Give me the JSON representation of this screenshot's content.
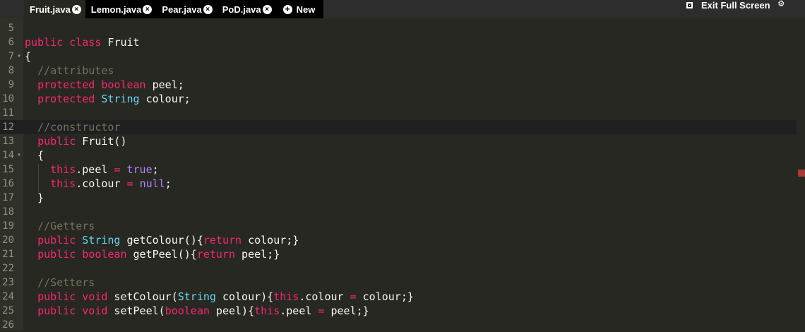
{
  "tabs": [
    {
      "label": "Fruit.java",
      "active": true
    },
    {
      "label": "Lemon.java",
      "active": false
    },
    {
      "label": "Pear.java",
      "active": false
    },
    {
      "label": "PoD.java",
      "active": false
    }
  ],
  "new_tab_label": "New",
  "fullscreen_label": "Exit Full Screen",
  "icons": {
    "close": "close-circle-icon",
    "new": "plus-circle-icon",
    "fullscreen": "exit-fullscreen-icon",
    "settings": "gear-icon",
    "fold": "fold-arrow-icon"
  },
  "colors": {
    "background": "#272822",
    "gutter": "#2f3129",
    "keyword": "#f92672",
    "type": "#66d9ef",
    "comment": "#75715e",
    "literal": "#ae81ff",
    "text": "#f8f8f2"
  },
  "current_line": 12,
  "code_lines": [
    {
      "n": 5,
      "tokens": []
    },
    {
      "n": 6,
      "tokens": [
        [
          "k",
          "public"
        ],
        [
          "p",
          " "
        ],
        [
          "k",
          "class"
        ],
        [
          "p",
          " Fruit"
        ]
      ]
    },
    {
      "n": 7,
      "fold": true,
      "tokens": [
        [
          "p",
          "{"
        ]
      ]
    },
    {
      "n": 8,
      "tokens": [
        [
          "p",
          "  "
        ],
        [
          "c",
          "//attributes"
        ]
      ]
    },
    {
      "n": 9,
      "tokens": [
        [
          "p",
          "  "
        ],
        [
          "k",
          "protected"
        ],
        [
          "p",
          " "
        ],
        [
          "k",
          "boolean"
        ],
        [
          "p",
          " peel;"
        ]
      ]
    },
    {
      "n": 10,
      "tokens": [
        [
          "p",
          "  "
        ],
        [
          "k",
          "protected"
        ],
        [
          "p",
          " "
        ],
        [
          "t",
          "String"
        ],
        [
          "p",
          " colour;"
        ]
      ]
    },
    {
      "n": 11,
      "tokens": []
    },
    {
      "n": 12,
      "tokens": [
        [
          "p",
          "  "
        ],
        [
          "c",
          "//constructor"
        ]
      ]
    },
    {
      "n": 13,
      "tokens": [
        [
          "p",
          "  "
        ],
        [
          "k",
          "public"
        ],
        [
          "p",
          " Fruit()"
        ]
      ]
    },
    {
      "n": 14,
      "fold": true,
      "tokens": [
        [
          "p",
          "  {"
        ]
      ]
    },
    {
      "n": 15,
      "tokens": [
        [
          "p",
          "    "
        ],
        [
          "k",
          "this"
        ],
        [
          "p",
          ".peel "
        ],
        [
          "k",
          "="
        ],
        [
          "p",
          " "
        ],
        [
          "b",
          "true"
        ],
        [
          "p",
          ";"
        ]
      ]
    },
    {
      "n": 16,
      "tokens": [
        [
          "p",
          "    "
        ],
        [
          "k",
          "this"
        ],
        [
          "p",
          ".colour "
        ],
        [
          "k",
          "="
        ],
        [
          "p",
          " "
        ],
        [
          "b",
          "null"
        ],
        [
          "p",
          ";"
        ]
      ]
    },
    {
      "n": 17,
      "tokens": [
        [
          "p",
          "  }"
        ]
      ]
    },
    {
      "n": 18,
      "tokens": []
    },
    {
      "n": 19,
      "tokens": [
        [
          "p",
          "  "
        ],
        [
          "c",
          "//Getters"
        ]
      ]
    },
    {
      "n": 20,
      "tokens": [
        [
          "p",
          "  "
        ],
        [
          "k",
          "public"
        ],
        [
          "p",
          " "
        ],
        [
          "t",
          "String"
        ],
        [
          "p",
          " getColour(){"
        ],
        [
          "k",
          "return"
        ],
        [
          "p",
          " colour;}"
        ]
      ]
    },
    {
      "n": 21,
      "tokens": [
        [
          "p",
          "  "
        ],
        [
          "k",
          "public"
        ],
        [
          "p",
          " "
        ],
        [
          "k",
          "boolean"
        ],
        [
          "p",
          " getPeel(){"
        ],
        [
          "k",
          "return"
        ],
        [
          "p",
          " peel;}"
        ]
      ]
    },
    {
      "n": 22,
      "tokens": []
    },
    {
      "n": 23,
      "tokens": [
        [
          "p",
          "  "
        ],
        [
          "c",
          "//Setters"
        ]
      ]
    },
    {
      "n": 24,
      "tokens": [
        [
          "p",
          "  "
        ],
        [
          "k",
          "public"
        ],
        [
          "p",
          " "
        ],
        [
          "k",
          "void"
        ],
        [
          "p",
          " setColour("
        ],
        [
          "t",
          "String"
        ],
        [
          "p",
          " colour){"
        ],
        [
          "k",
          "this"
        ],
        [
          "p",
          ".colour "
        ],
        [
          "k",
          "="
        ],
        [
          "p",
          " colour;}"
        ]
      ]
    },
    {
      "n": 25,
      "tokens": [
        [
          "p",
          "  "
        ],
        [
          "k",
          "public"
        ],
        [
          "p",
          " "
        ],
        [
          "k",
          "void"
        ],
        [
          "p",
          " setPeel("
        ],
        [
          "k",
          "boolean"
        ],
        [
          "p",
          " peel){"
        ],
        [
          "k",
          "this"
        ],
        [
          "p",
          ".peel "
        ],
        [
          "k",
          "="
        ],
        [
          "p",
          " peel;}"
        ]
      ]
    },
    {
      "n": 26,
      "tokens": []
    }
  ]
}
